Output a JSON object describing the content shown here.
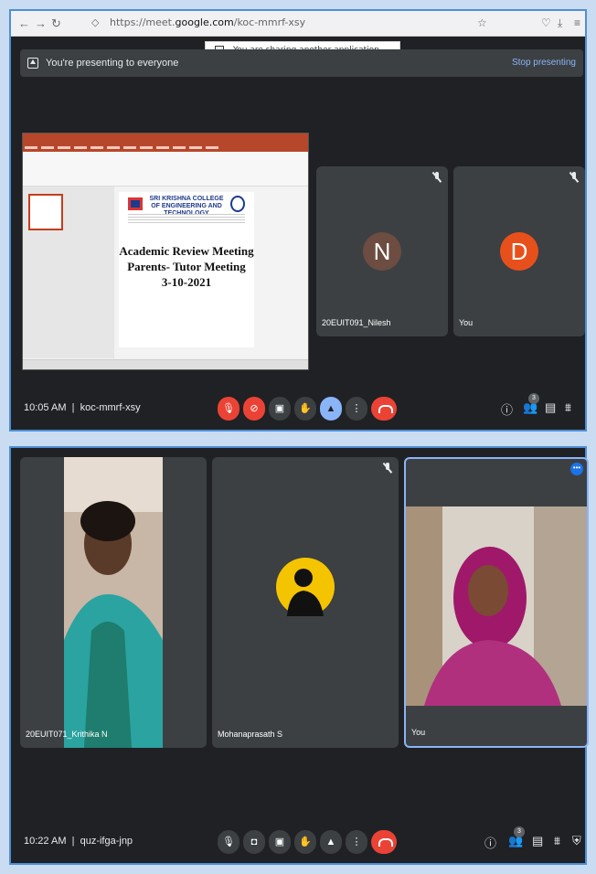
{
  "browser": {
    "url_prefix": "https://meet.",
    "url_domain": "google.com",
    "url_path": "/koc-mmrf-xsy",
    "share_notice": "You are sharing another application window."
  },
  "presenting": {
    "text": "You're presenting to everyone",
    "stop": "Stop presenting"
  },
  "slide": {
    "college_name": "SRI KRISHNA COLLEGE OF ENGINEERING AND TECHNOLOGY",
    "line1": "Academic Review Meeting",
    "line2": "Parents- Tutor Meeting",
    "line3": "3-10-2021"
  },
  "meeting1": {
    "tiles": [
      {
        "initial": "N",
        "name": "20EUIT091_Nilesh",
        "avatar_color": "#6d4c41"
      },
      {
        "initial": "D",
        "name": "You",
        "avatar_color": "#e8501b"
      }
    ],
    "time": "10:05 AM",
    "code": "koc-mmrf-xsy",
    "people_count": "3"
  },
  "meeting2": {
    "tiles": [
      {
        "name": "20EUIT071_Krithika N"
      },
      {
        "name": "Mohanaprasath S"
      },
      {
        "name": "You"
      }
    ],
    "time": "10:22 AM",
    "code": "quz-ifga-jnp",
    "people_count": "3"
  },
  "colors": {
    "meet_bg": "#202124",
    "tile_bg": "#3c4043",
    "end_call": "#ea4335",
    "active": "#8ab4f8"
  },
  "icons": [
    "mic-off-icon",
    "camera-off-icon",
    "captions-icon",
    "raise-hand-icon",
    "present-icon",
    "more-icon",
    "end-call-icon",
    "info-icon",
    "people-icon",
    "chat-icon",
    "activities-icon",
    "host-controls-icon"
  ]
}
